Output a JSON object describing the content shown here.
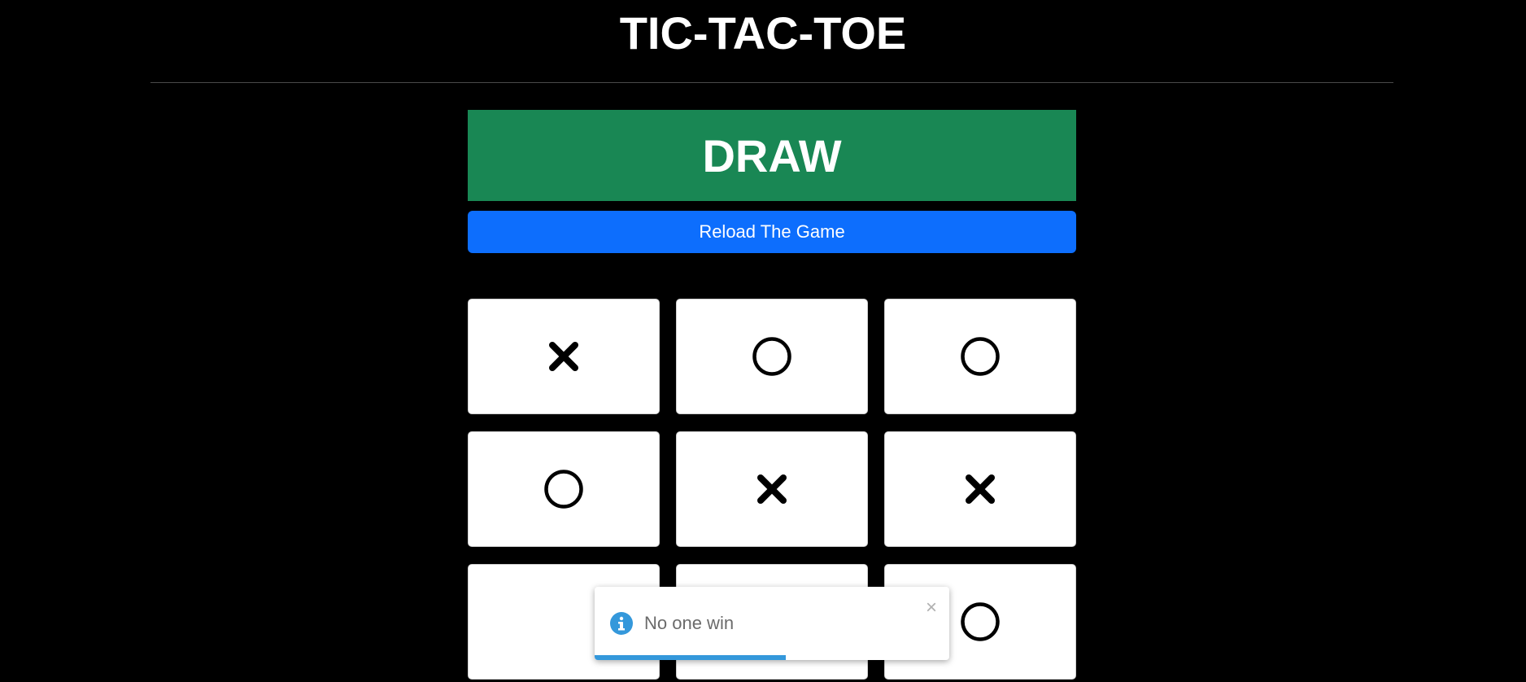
{
  "header": {
    "title": "TIC-TAC-TOE"
  },
  "status": {
    "label": "DRAW",
    "color": "#198754"
  },
  "reload_button": {
    "label": "Reload The Game",
    "color": "#0d6efd"
  },
  "board": {
    "cells": [
      "X",
      "O",
      "O",
      "O",
      "X",
      "X",
      "",
      "",
      "O"
    ]
  },
  "toast": {
    "icon": "info-icon",
    "message": "No one win",
    "close_icon": "close-icon",
    "progress_fraction": 0.54,
    "accent_color": "#3498db"
  }
}
